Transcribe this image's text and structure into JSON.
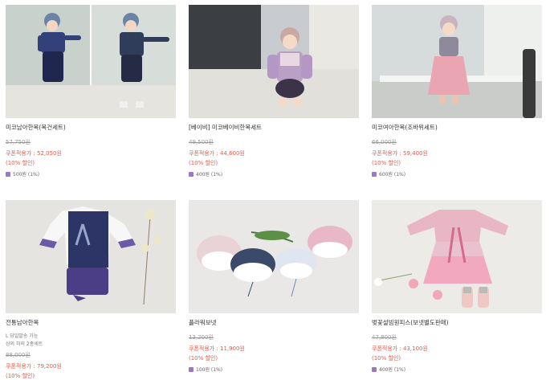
{
  "products": [
    {
      "name": "미코남아한복(복건세트)",
      "notes": [],
      "original_price": "57,750원",
      "coupon_price": "쿠폰적용가 : 52,050원",
      "discount": "(10% 할인)",
      "points": "500원 (1%)"
    },
    {
      "name": "[베이비] 미코베이비한복세트",
      "notes": [],
      "original_price": "49,500원",
      "coupon_price": "쿠폰적용가 : 44,600원",
      "discount": "(10% 할인)",
      "points": "400원 (1%)"
    },
    {
      "name": "미코여아한복(조바위세트)",
      "notes": [],
      "original_price": "66,000원",
      "coupon_price": "쿠폰적용가 : 59,400원",
      "discount": "(10% 할인)",
      "points": "600원 (1%)"
    },
    {
      "name": "전통남아한복",
      "notes": [
        "L 당일발송 가능",
        "상의 하의 2종세트"
      ],
      "original_price": "88,000원",
      "coupon_price": "쿠폰적용가 : 79,200원",
      "discount": "(10% 할인)",
      "points": ""
    },
    {
      "name": "플라워보넷",
      "notes": [],
      "original_price": "13,200원",
      "coupon_price": "쿠폰적용가 : 11,900원",
      "discount": "(10% 할인)",
      "points": "100원 (1%)"
    },
    {
      "name": "벚꽃설빔원피스(보넷별도판매)",
      "notes": [],
      "original_price": "47,800원",
      "coupon_price": "쿠폰적용가 : 43,100원",
      "discount": "(10% 할인)",
      "points": "400원 (1%)"
    }
  ],
  "colors": {
    "sale": "#e15a4c",
    "strike": "#999999",
    "points_icon": "#9a78c8"
  }
}
